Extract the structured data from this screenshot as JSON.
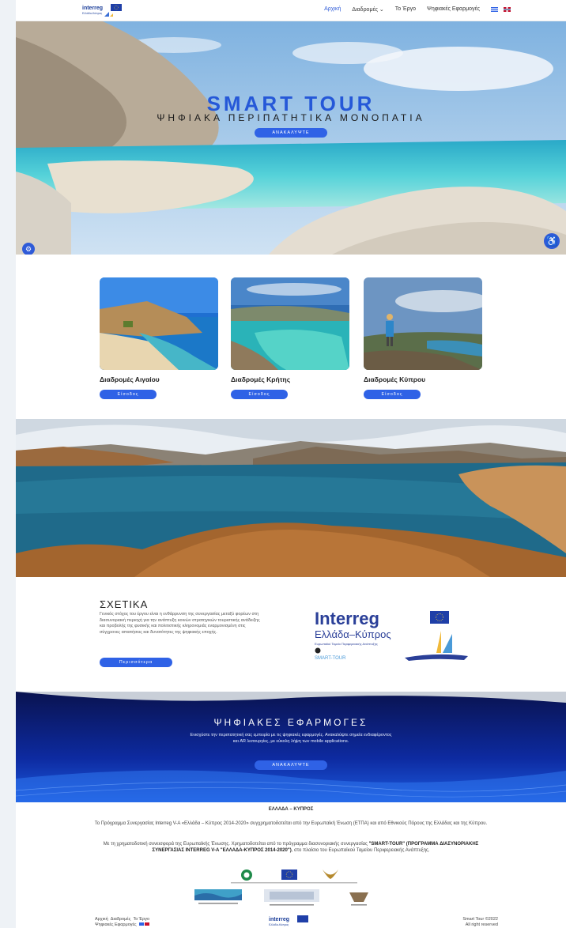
{
  "nav": {
    "items": [
      "Αρχική",
      "Διαδρομές",
      "Το Έργο",
      "Ψηφιακές Εφαρμογές"
    ],
    "dropdown_indicator": "⌄"
  },
  "logo_text": {
    "top": "interreg",
    "bottom": "Ελλάδα-Κύπρος"
  },
  "hero": {
    "title": "SMART TOUR",
    "subtitle": "ΨΗΦΙΑΚΑ ΠΕΡΙΠΑΤΗΤΙΚΑ ΜΟΝΟΠΑΤΙΑ",
    "button": "ΑΝΑΚΑΛΥΨΤΕ"
  },
  "routes": [
    {
      "title": "Διαδρομές Αιγαίου",
      "button": "Είσοδος"
    },
    {
      "title": "Διαδρομές Κρήτης",
      "button": "Είσοδος"
    },
    {
      "title": "Διαδρομές Κύπρου",
      "button": "Είσοδος"
    }
  ],
  "about": {
    "title": "ΣΧΕΤΙΚΑ",
    "text": "Γενικός στόχος του έργου είναι η ενθάρρυνση της συνεργασίας μεταξύ φορέων στη διασυνοριακή περιοχή για την ανάπτυξη κοινών στρατηγικών τουριστικής ανάδειξης και προβολής της φυσικής και πολιτιστικής κληρονομιάς εναρμονισμένη στις σύγχρονες απαιτήσεις και δυνατότητες της ψηφιακής εποχής.",
    "button": "Περισσότερα",
    "logo": {
      "word": "Interreg",
      "region": "Ελλάδα–Κύπρος",
      "fund": "Ευρωπαϊκό Ταμείο Περιφερειακής Ανάπτυξης",
      "project": "SMART-TOUR"
    }
  },
  "apps": {
    "title": "ΨΗΦΙΑΚΕΣ ΕΦΑΡΜΟΓΕΣ",
    "text": "Ενισχύστε την περιπατητική σας εμπειρία με τις ψηφιακές εφαρμογές. Ανακαλύψτε σημεία ενδιαφέροντος και AR λειτουργίες, με εύκολη λήψη των mobile applications.",
    "button": "ΑΝΑΚΑΛΥΨΤΕ"
  },
  "footer": {
    "heading": "ΕΛΛΑΔΑ – ΚΥΠΡΟΣ",
    "p1": "Το Πρόγραμμα Συνεργασίας Interreg V-A «Ελλάδα – Κύπρος 2014-2020» συγχρηματοδοτείται από την Ευρωπαϊκή Ένωση (ΕΤΠΑ) και από Εθνικούς Πόρους της Ελλάδας και της Κύπρου.",
    "p2_prefix": "Με τη χρηματοδοτική συνεισφορά της Ευρωπαϊκής Ένωσης. Χρηματοδοτείται από το πρόγραμμα διασυνοριακής συνεργασίας ",
    "p2_bold": "\"SMART-TOUR\" (ΠΡΟΓΡΑΜΜΑ ΔΙΑΣΥΝΟΡΙΑΚΗΣ ΣΥΝΕΡΓΑΣΙΑΣ INTERREG V-A \"ΕΛΛΑΔΑ-ΚΥΠΡΟΣ 2014-2020\")",
    "p2_suffix": ", στο πλαίσιο του Ευρωπαϊκού Ταμείου Περιφερειακής Ανάπτυξης.",
    "links": [
      "Αρχική",
      "Διαδρομές",
      "Το Έργο",
      "Ψηφιακές Εφαρμογές"
    ],
    "copyright": "Smart Tour ©2022",
    "rights": "All right reserved"
  },
  "colors": {
    "accent": "#2f62e6",
    "title_blue": "#2558d8",
    "apps_bg": "#0b1e7a"
  }
}
